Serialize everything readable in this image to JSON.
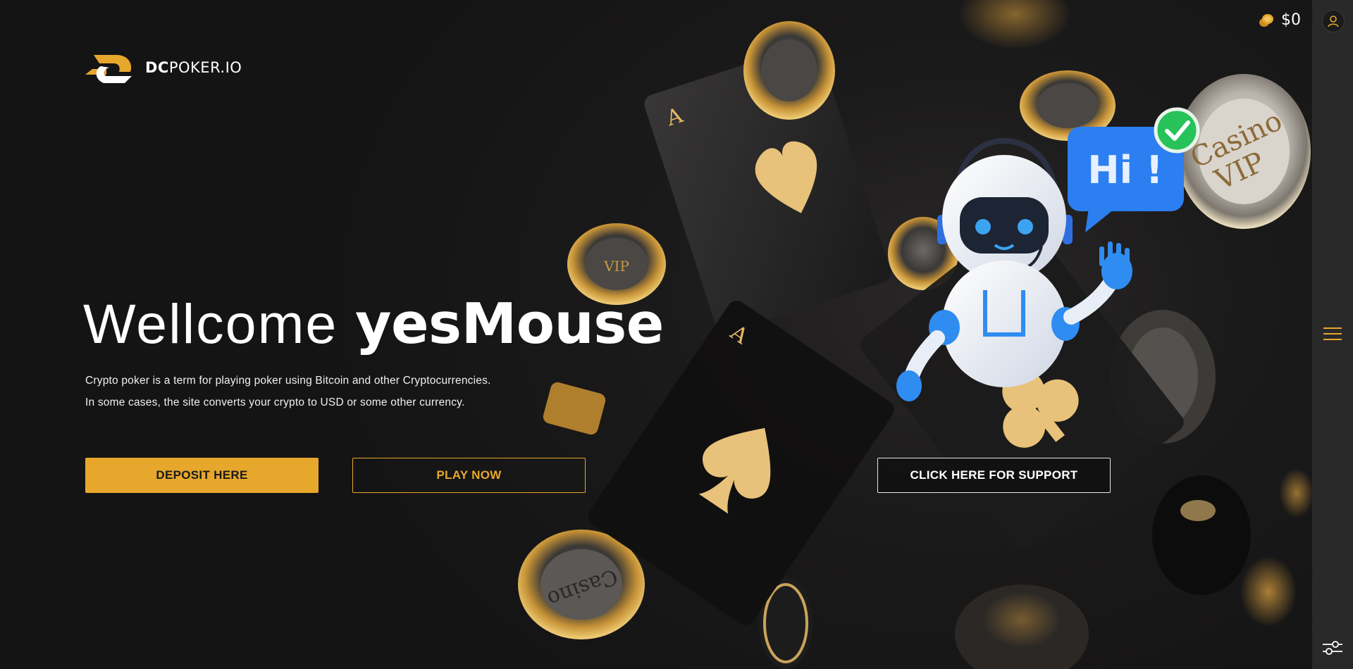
{
  "brand": {
    "logo_bold": "DC",
    "logo_regular": "POKER.IO",
    "accent_color": "#e6a72c"
  },
  "header": {
    "balance": "$0",
    "icons": [
      "coins-icon",
      "user-icon"
    ]
  },
  "rail": {
    "icons": [
      "hamburger-menu-icon",
      "settings-sliders-icon"
    ]
  },
  "hero": {
    "headline_prefix": "Wellcome",
    "headline_name": "yesMouse",
    "description_line1": "Crypto poker is a term for playing poker using Bitcoin and other Cryptocurrencies.",
    "description_line2": "In some cases, the site converts your crypto to USD or some other currency.",
    "bubble_text": "Hi !"
  },
  "buttons": {
    "deposit": "DEPOSIT HERE",
    "play": "PLAY NOW",
    "support": "CLICK HERE FOR SUPPORT"
  },
  "colors": {
    "background": "#161516",
    "rail": "#2a292a",
    "gold": "#e6a72c",
    "bubble_blue": "#1e88e5"
  }
}
